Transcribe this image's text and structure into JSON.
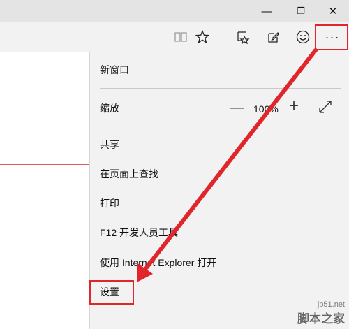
{
  "window": {
    "minimize_glyph": "—",
    "restore_glyph": "❐",
    "close_glyph": "✕"
  },
  "toolbar": {
    "icons": [
      "reading-view-icon",
      "favorites-star-icon",
      "hub-icon",
      "web-note-icon",
      "feedback-smiley-icon",
      "more-actions-icon"
    ],
    "more_label": "···"
  },
  "menu": {
    "new_window": "新窗口",
    "zoom_label": "缩放",
    "zoom_value": "100%",
    "share": "共享",
    "find_on_page": "在页面上查找",
    "print": "打印",
    "dev_tools": "F12 开发人员工具",
    "open_with_ie": "使用 Internet Explorer 打开",
    "settings": "设置"
  },
  "annotation": {
    "highlight_color": "#e0252b"
  },
  "watermark": {
    "url": "jb51.net",
    "site": "脚本之家"
  }
}
